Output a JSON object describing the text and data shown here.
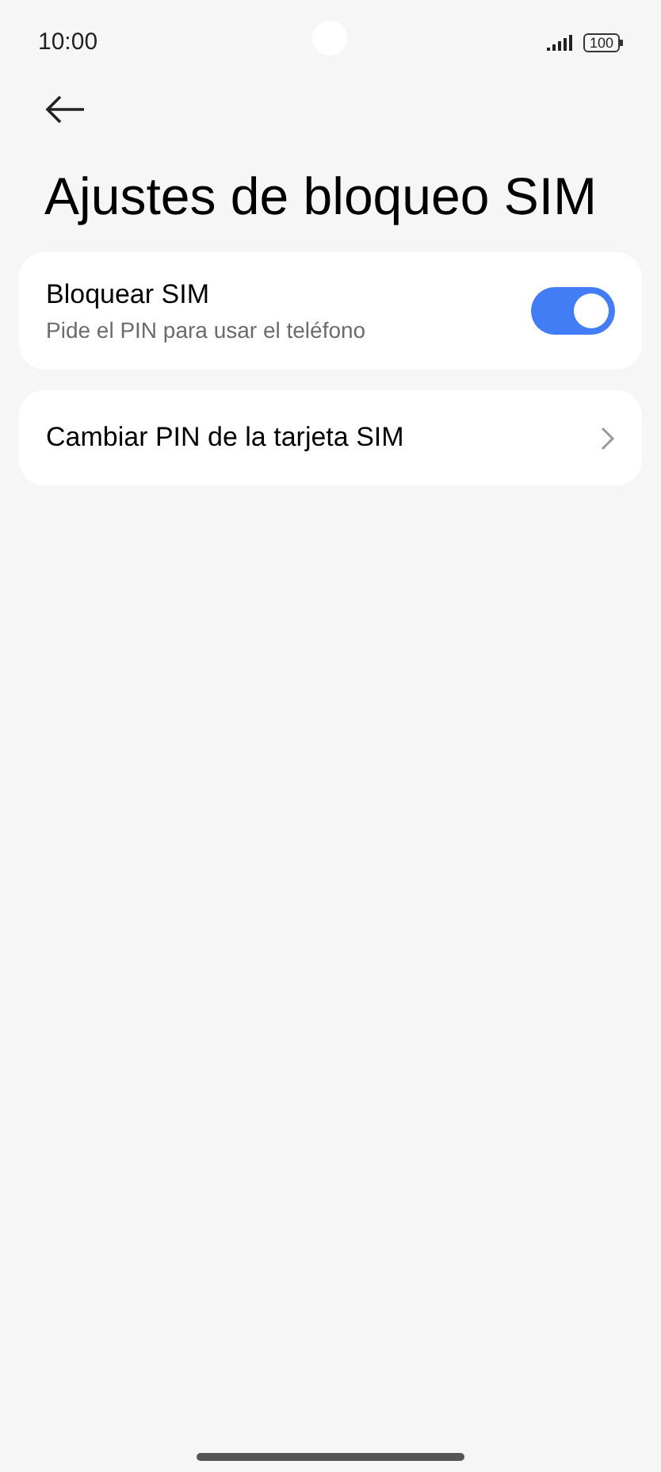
{
  "status_bar": {
    "time": "10:00",
    "battery": "100"
  },
  "title": "Ajustes de bloqueo SIM",
  "items": [
    {
      "kind": "toggle",
      "label": "Bloquear SIM",
      "subtitle": "Pide el PIN para usar el teléfono",
      "on": true
    },
    {
      "kind": "link",
      "label": "Cambiar PIN de la tarjeta SIM"
    }
  ]
}
